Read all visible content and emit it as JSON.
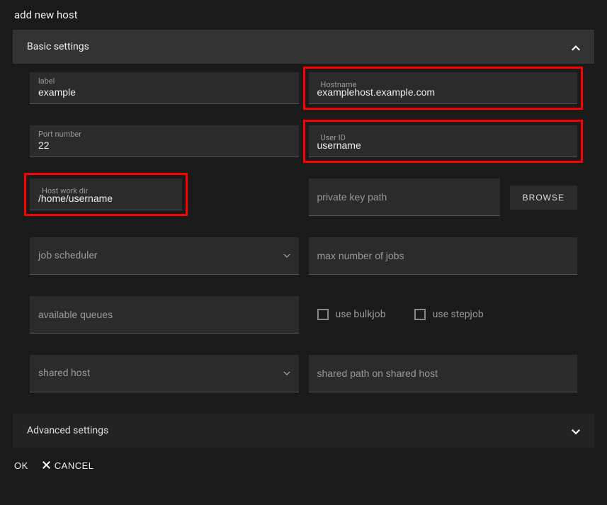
{
  "dialog": {
    "title": "add new host"
  },
  "sections": {
    "basic": {
      "title": "Basic settings"
    },
    "advanced": {
      "title": "Advanced settings"
    }
  },
  "fields": {
    "label": {
      "label": "label",
      "value": "example"
    },
    "hostname": {
      "label": "Hostname",
      "value": "examplehost.example.com"
    },
    "port": {
      "label": "Port number",
      "value": "22"
    },
    "userid": {
      "label": "User ID",
      "value": "username"
    },
    "workdir": {
      "label": "Host work dir",
      "value": "/home/username"
    },
    "privatekey": {
      "placeholder": "private key path"
    },
    "scheduler": {
      "placeholder": "job scheduler"
    },
    "maxjobs": {
      "placeholder": "max number of jobs"
    },
    "queues": {
      "placeholder": "available queues"
    },
    "bulkjob": {
      "label": "use bulkjob"
    },
    "stepjob": {
      "label": "use stepjob"
    },
    "sharedhost": {
      "placeholder": "shared host"
    },
    "sharedpath": {
      "placeholder": "shared path on shared host"
    }
  },
  "buttons": {
    "browse": "BROWSE",
    "ok": "OK",
    "cancel": "CANCEL"
  }
}
